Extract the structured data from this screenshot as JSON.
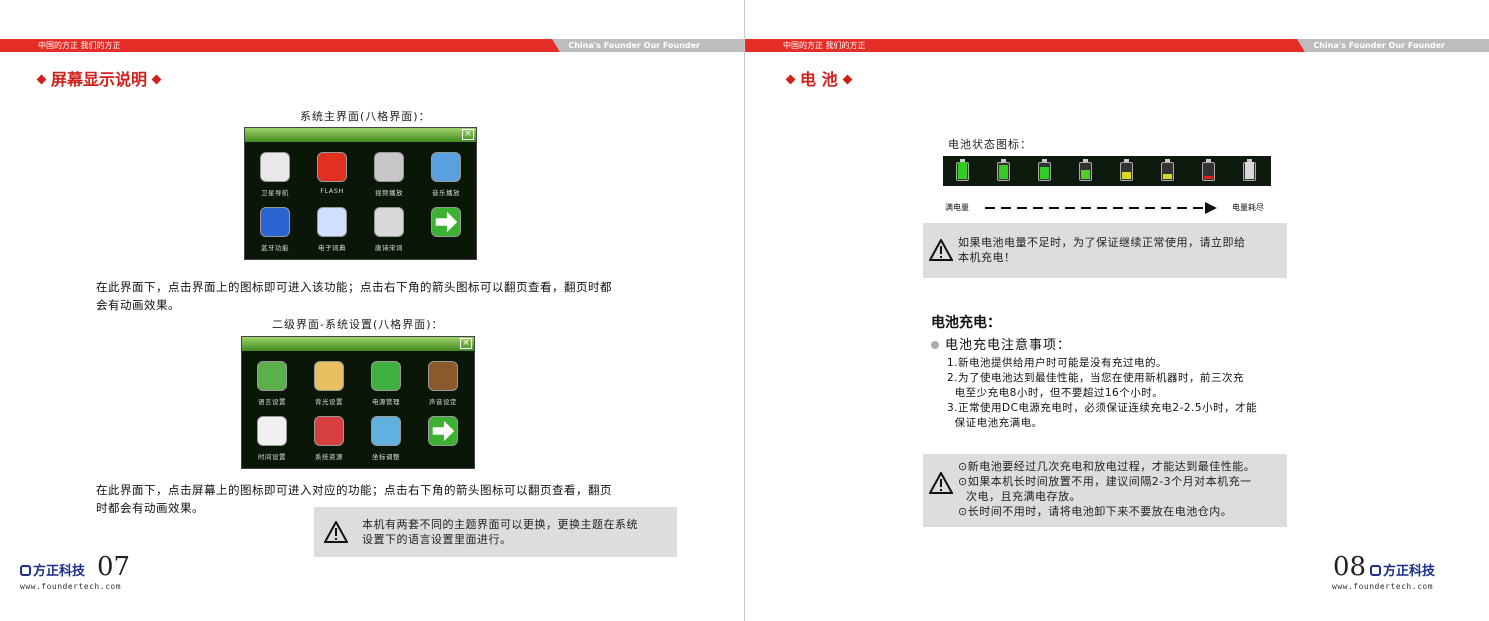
{
  "header": {
    "left_text": "中国的方正 我们的方正",
    "right_text": "China's Founder Our Founder"
  },
  "left": {
    "section_title": "屏幕显示说明",
    "caption1": "系统主界面(八格界面)：",
    "screen1_labels": [
      "卫星导航",
      "FLASH",
      "视频播放",
      "音乐播放",
      "蓝牙功能",
      "电子词典",
      "唐诗宋词",
      ""
    ],
    "para1_l1": "在此界面下，点击界面上的图标即可进入该功能；点击右下角的箭头图标可以翻页查看，翻页时都",
    "para1_l2": "会有动画效果。",
    "caption2": "二级界面-系统设置(八格界面)：",
    "screen2_labels": [
      "语言设置",
      "背光设置",
      "电源管理",
      "声音设定",
      "时间设置",
      "系统资源",
      "坐标调整",
      ""
    ],
    "para2_l1": "在此界面下，点击屏幕上的图标即可进入对应的功能；点击右下角的箭头图标可以翻页查看，翻页",
    "para2_l2": "时都会有动画效果。",
    "note_l1": "本机有两套不同的主题界面可以更换，更换主题在系统",
    "note_l2": "设置下的语言设置里面进行。",
    "logo_text": "方正科技",
    "page_number": "07",
    "url": "www.foundertech.com"
  },
  "right": {
    "section_title": "电 池",
    "battery_caption": "电池状态图标：",
    "battery_levels": [
      1.0,
      0.85,
      0.7,
      0.55,
      0.4,
      0.3,
      0.15,
      0.0
    ],
    "battery_colors": [
      "#33cc22",
      "#33cc22",
      "#33cc22",
      "#55cc22",
      "#d8d820",
      "#d8d820",
      "#dd2222",
      "#888888"
    ],
    "full_label": "满电量",
    "empty_label": "电量耗尽",
    "warn1_l1": "如果电池电量不足时，为了保证继续正常使用，请立即给",
    "warn1_l2": "本机充电！",
    "charge_title": "电池充电：",
    "notes_title": "电池充电注意事项：",
    "notes": [
      "1.新电池提供给用户时可能是没有充过电的。",
      "2.为了使电池达到最佳性能，当您在使用新机器时，前三次充",
      "  电至少充电8小时，但不要超过16个小时。",
      "3.正常使用DC电源充电时，必须保证连续充电2-2.5小时，才能",
      "  保证电池充满电。"
    ],
    "tips": [
      "⊙新电池要经过几次充电和放电过程，才能达到最佳性能。",
      "⊙如果本机长时间放置不用，建议间隔2-3个月对本机充一",
      "  次电，且充满电存放。",
      "⊙长时间不用时，请将电池卸下来不要放在电池仓内。"
    ],
    "logo_text": "方正科技",
    "page_number": "08",
    "url": "www.foundertech.com"
  }
}
